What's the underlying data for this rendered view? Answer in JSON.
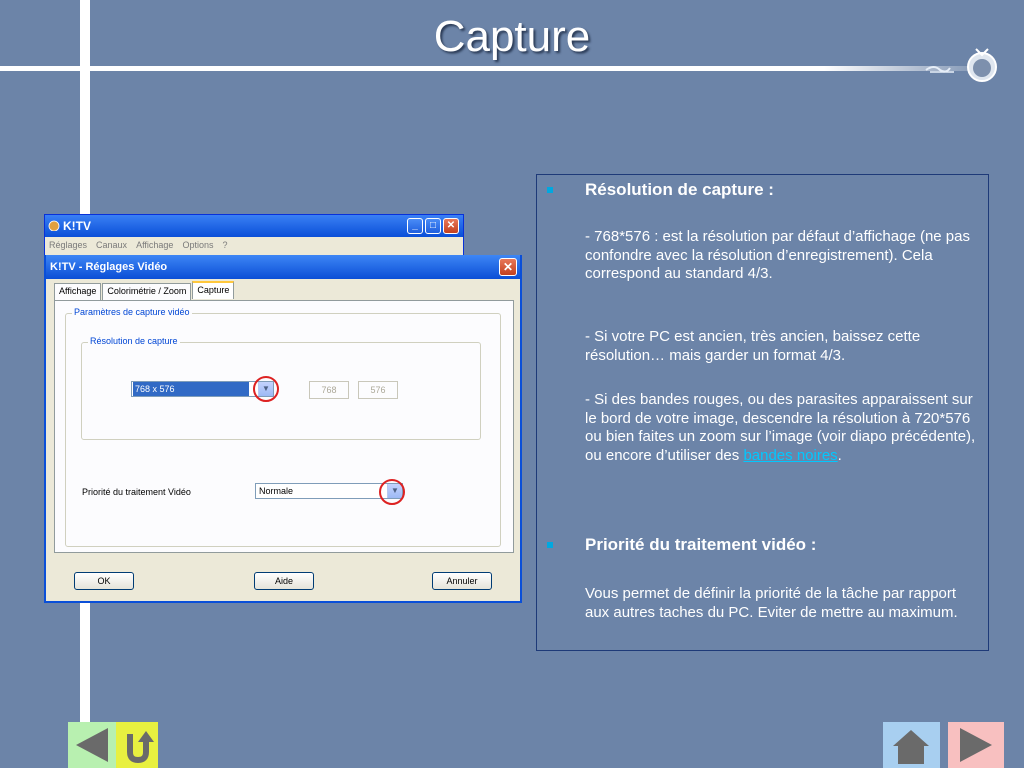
{
  "slide": {
    "title": "Capture"
  },
  "kitv_window": {
    "title": "K!TV",
    "menu": [
      "Réglages",
      "Canaux",
      "Affichage",
      "Options",
      "?"
    ]
  },
  "dialog": {
    "title": "K!TV - Réglages Vidéo",
    "tabs": [
      "Affichage",
      "Colorimétrie / Zoom",
      "Capture"
    ],
    "active_tab": "Capture",
    "group_outer_label": "Paramètres de capture vidéo",
    "group_inner_label": "Résolution de capture",
    "resolution_value": "768 x 576",
    "width_value": "768",
    "height_value": "576",
    "priority_label": "Priorité du traitement Vidéo",
    "priority_value": "Normale",
    "ok_label": "OK",
    "help_label": "Aide",
    "cancel_label": "Annuler"
  },
  "panel": {
    "heading1": "Résolution de capture :",
    "p1": "- 768*576 : est la résolution par défaut d’affichage (ne pas confondre avec la résolution d’enregistrement). Cela correspond au standard 4/3.",
    "p2": "- Si votre PC est ancien, très ancien, baissez cette résolution… mais garder un format 4/3.",
    "p3_before": "- Si des bandes rouges, ou des parasites apparaissent sur le bord de votre image, descendre la résolution à 720*576 ou bien faites un zoom sur l’image (voir diapo précédente), ou encore d’utiliser des ",
    "p3_link": "bandes noires",
    "p3_after": ".",
    "heading2": "Priorité du traitement vidéo :",
    "p4": "Vous permet de définir la priorité de la tâche par rapport aux autres taches du PC. Eviter de mettre au maximum."
  },
  "colors": {
    "background": "#6c84a8",
    "bullet": "#00a8e0",
    "link": "#00c8ff",
    "xp_titlebar": "#0a4fd8"
  },
  "icons": [
    "tv-logo-icon",
    "arrow-left-icon",
    "return-arrow-icon",
    "home-icon",
    "arrow-right-icon"
  ]
}
